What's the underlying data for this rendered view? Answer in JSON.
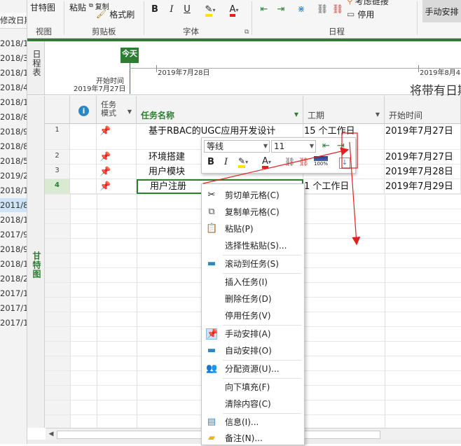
{
  "background_column": {
    "header": "修改日期",
    "dates": [
      "2018/1",
      "2018/3",
      "2018/1",
      "2018/4",
      "2018/1",
      "2018/8",
      "2018/9",
      "2018/8",
      "2018/5",
      "2019/2",
      "2018/1",
      "2011/8",
      "2018/1",
      "2017/9",
      "2018/9",
      "2018/1",
      "2018/2",
      "2017/1",
      "2017/1",
      "2017/1"
    ]
  },
  "ribbon": {
    "gantt_view_label": "甘特图",
    "view_group_label": "视图",
    "paste_label": "粘贴",
    "copy_label": "复制",
    "format_painter_label": "格式刷",
    "clipboard_group_label": "剪贴板",
    "font_group_label": "字体",
    "schedule_group_label": "日程",
    "respect_links_label": "考虑链接",
    "inactivate_label": "停用",
    "manual_schedule_label": "手动安排",
    "bold": "B",
    "italic": "I",
    "underline": "U",
    "font_color_letter": "A"
  },
  "timeline": {
    "side_label": "日程表",
    "today_label": "今天",
    "start_label": "开始时间",
    "start_date": "2019年7月27日",
    "tick1": "2019年7月28日",
    "tick2": "2019年8月4",
    "placeholder": "将带有日期"
  },
  "grid": {
    "side_label": "甘特图",
    "headers": {
      "info": "i",
      "mode": "任务模式",
      "name": "任务名称",
      "duration": "工期",
      "start": "开始时间"
    },
    "rows": [
      {
        "num": "1",
        "name": "基于RBAC的UGC应用开发设计",
        "duration": "15 个工作日",
        "start": "2019年7月27日"
      },
      {
        "num": "2",
        "name": "环境搭建",
        "duration": "",
        "start": "2019年7月27日"
      },
      {
        "num": "3",
        "name": "用户模块",
        "duration": "",
        "start": "2019年7月28日"
      },
      {
        "num": "4",
        "name": "用户注册",
        "duration": "1 个工作日",
        "start": "2019年7月29日"
      }
    ]
  },
  "mini_toolbar": {
    "font": "等线",
    "size": "11",
    "bold": "B",
    "italic": "I",
    "font_color_letter": "A",
    "percent": "100%"
  },
  "context_menu": {
    "items": [
      {
        "label": "剪切单元格(C)",
        "icon": "scissors-icon"
      },
      {
        "label": "复制单元格(C)",
        "icon": "copy-icon"
      },
      {
        "label": "粘贴(P)",
        "icon": "paste-icon"
      },
      {
        "label": "选择性粘贴(S)...",
        "icon": ""
      },
      {
        "label": "滚动到任务(S)",
        "icon": "scroll-to-task-icon"
      },
      {
        "label": "插入任务(I)",
        "icon": ""
      },
      {
        "label": "删除任务(D)",
        "icon": ""
      },
      {
        "label": "停用任务(V)",
        "icon": ""
      },
      {
        "label": "手动安排(A)",
        "icon": "pin-icon"
      },
      {
        "label": "自动安排(O)",
        "icon": "auto-schedule-icon"
      },
      {
        "label": "分配资源(U)...",
        "icon": "people-icon"
      },
      {
        "label": "向下填充(F)",
        "icon": ""
      },
      {
        "label": "清除内容(C)",
        "icon": ""
      },
      {
        "label": "信息(I)...",
        "icon": "info-icon"
      },
      {
        "label": "备注(N)...",
        "icon": "note-icon"
      }
    ]
  },
  "colors": {
    "accent_green": "#2e7d32",
    "pin_blue": "#2e86c1",
    "annotation_red": "#e02020"
  }
}
